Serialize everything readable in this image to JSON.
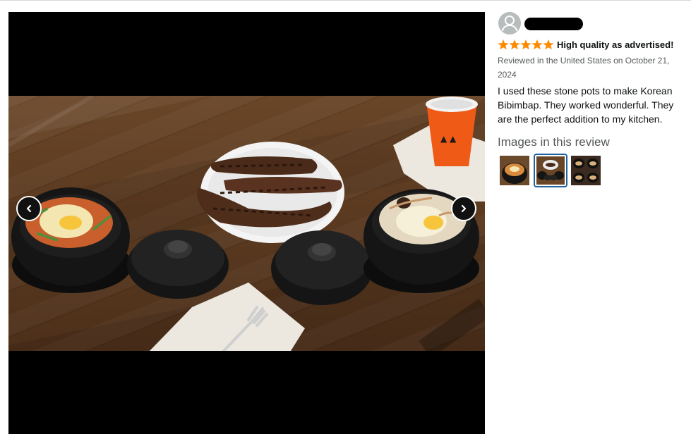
{
  "reviewer": {
    "name": ""
  },
  "review": {
    "rating": 5,
    "rating_max": 5,
    "title": "High quality as advertised!",
    "meta": "Reviewed in the United States on October 21, 2024",
    "body": "I used these stone pots to make Korean Bibimbap. They worked wonderful. They are the perfect addition to my kitchen."
  },
  "images_section": {
    "heading": "Images in this review",
    "thumbnail_count": 3,
    "selected_index": 1
  },
  "colors": {
    "star": "#ff8a00",
    "selected_border": "#2162a1",
    "meta_text": "#565959",
    "body_text": "#0f1111"
  },
  "icons": {
    "prev": "chevron-left-icon",
    "next": "chevron-right-icon",
    "avatar": "user-avatar-icon",
    "star": "star-icon"
  }
}
